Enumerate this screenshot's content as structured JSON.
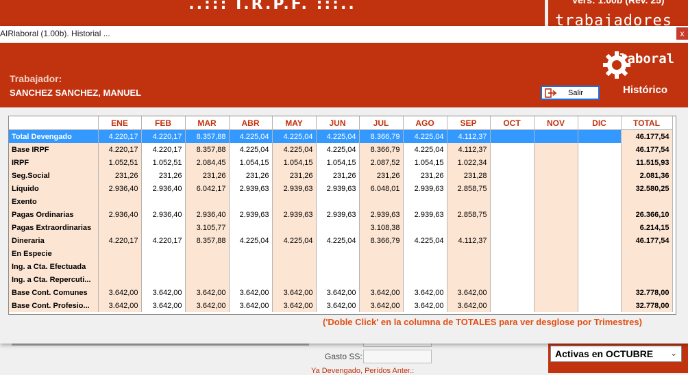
{
  "background": {
    "banner_title": "..:::   I.R.P.F.   :::..",
    "version": "Vers: 1.00b (Rev. 25)",
    "workers_label": "trabajadores",
    "active_select": "Activas en OCTUBRE",
    "gasto_ss_label": "Gasto SS:",
    "devengado_label": "Ya Devengado, Perídos Anter.:"
  },
  "window": {
    "title": "AIRlaboral (1.00b). Historial ...",
    "close_symbol": "x"
  },
  "header": {
    "trabajador_label": "Trabajador:",
    "trabajador_name": "SANCHEZ SANCHEZ, MANUEL",
    "salir_label": "Salir",
    "logo_text": "laboral",
    "historico_label": "Histórico"
  },
  "table": {
    "columns": [
      "",
      "ENE",
      "FEB",
      "MAR",
      "ABR",
      "MAY",
      "JUN",
      "JUL",
      "AGO",
      "SEP",
      "OCT",
      "NOV",
      "DIC",
      "TOTAL"
    ],
    "rows": [
      {
        "label": "Total Devengado",
        "values": [
          "4.220,17",
          "4.220,17",
          "8.357,88",
          "4.225,04",
          "4.225,04",
          "4.225,04",
          "8.366,79",
          "4.225,04",
          "4.112,37",
          "",
          "",
          ""
        ],
        "total": "46.177,54",
        "selected": true
      },
      {
        "label": "Base IRPF",
        "values": [
          "4.220,17",
          "4.220,17",
          "8.357,88",
          "4.225,04",
          "4.225,04",
          "4.225,04",
          "8.366,79",
          "4.225,04",
          "4.112,37",
          "",
          "",
          ""
        ],
        "total": "46.177,54"
      },
      {
        "label": "IRPF",
        "values": [
          "1.052,51",
          "1.052,51",
          "2.084,45",
          "1.054,15",
          "1.054,15",
          "1.054,15",
          "2.087,52",
          "1.054,15",
          "1.022,34",
          "",
          "",
          ""
        ],
        "total": "11.515,93"
      },
      {
        "label": "Seg.Social",
        "values": [
          "231,26",
          "231,26",
          "231,26",
          "231,26",
          "231,26",
          "231,26",
          "231,26",
          "231,26",
          "231,28",
          "",
          "",
          ""
        ],
        "total": "2.081,36"
      },
      {
        "label": "Líquido",
        "values": [
          "2.936,40",
          "2.936,40",
          "6.042,17",
          "2.939,63",
          "2.939,63",
          "2.939,63",
          "6.048,01",
          "2.939,63",
          "2.858,75",
          "",
          "",
          ""
        ],
        "total": "32.580,25"
      },
      {
        "label": "Exento",
        "values": [
          "",
          "",
          "",
          "",
          "",
          "",
          "",
          "",
          "",
          "",
          "",
          ""
        ],
        "total": ""
      },
      {
        "label": "Pagas Ordinarias",
        "values": [
          "2.936,40",
          "2.936,40",
          "2.936,40",
          "2.939,63",
          "2.939,63",
          "2.939,63",
          "2.939,63",
          "2.939,63",
          "2.858,75",
          "",
          "",
          ""
        ],
        "total": "26.366,10"
      },
      {
        "label": "Pagas Extraordinarias",
        "values": [
          "",
          "",
          "3.105,77",
          "",
          "",
          "",
          "3.108,38",
          "",
          "",
          "",
          "",
          ""
        ],
        "total": "6.214,15"
      },
      {
        "label": "Dineraria",
        "values": [
          "4.220,17",
          "4.220,17",
          "8.357,88",
          "4.225,04",
          "4.225,04",
          "4.225,04",
          "8.366,79",
          "4.225,04",
          "4.112,37",
          "",
          "",
          ""
        ],
        "total": "46.177,54"
      },
      {
        "label": "En Especie",
        "values": [
          "",
          "",
          "",
          "",
          "",
          "",
          "",
          "",
          "",
          "",
          "",
          ""
        ],
        "total": ""
      },
      {
        "label": "Ing. a Cta. Efectuada",
        "values": [
          "",
          "",
          "",
          "",
          "",
          "",
          "",
          "",
          "",
          "",
          "",
          ""
        ],
        "total": ""
      },
      {
        "label": "Ing. a Cta. Repercuti...",
        "values": [
          "",
          "",
          "",
          "",
          "",
          "",
          "",
          "",
          "",
          "",
          "",
          ""
        ],
        "total": ""
      },
      {
        "label": "Base Cont. Comunes",
        "values": [
          "3.642,00",
          "3.642,00",
          "3.642,00",
          "3.642,00",
          "3.642,00",
          "3.642,00",
          "3.642,00",
          "3.642,00",
          "3.642,00",
          "",
          "",
          ""
        ],
        "total": "32.778,00"
      },
      {
        "label": "Base Cont. Profesio...",
        "values": [
          "3.642,00",
          "3.642,00",
          "3.642,00",
          "3.642,00",
          "3.642,00",
          "3.642,00",
          "3.642,00",
          "3.642,00",
          "3.642,00",
          "",
          "",
          ""
        ],
        "total": "32.778,00"
      }
    ]
  },
  "hint": "('Doble Click' en la columna de TOTALES para ver desglose por Trimestres)"
}
